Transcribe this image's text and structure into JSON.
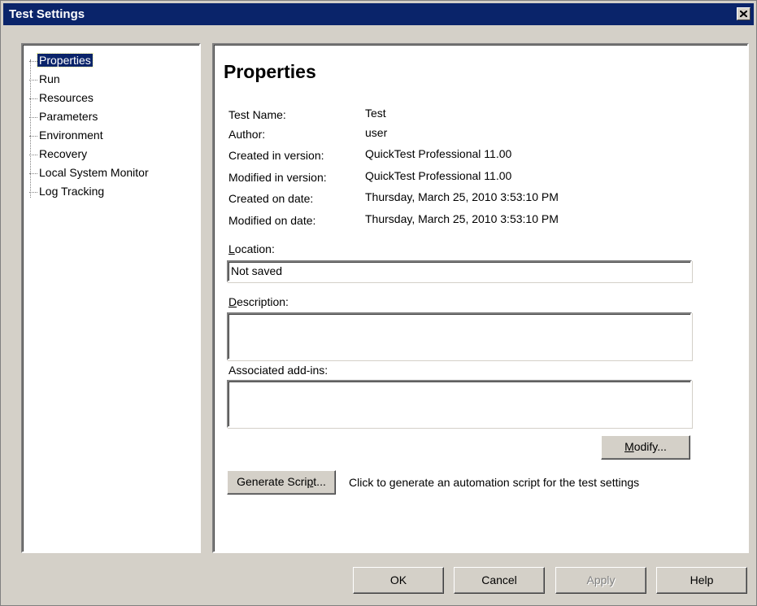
{
  "window": {
    "title": "Test Settings"
  },
  "tree": {
    "items": [
      {
        "label": "Properties",
        "selected": true
      },
      {
        "label": "Run"
      },
      {
        "label": "Resources"
      },
      {
        "label": "Parameters"
      },
      {
        "label": "Environment"
      },
      {
        "label": "Recovery"
      },
      {
        "label": "Local System Monitor"
      },
      {
        "label": "Log Tracking"
      }
    ]
  },
  "properties": {
    "heading": "Properties",
    "rows": [
      {
        "label": "Test Name:",
        "value": "Test"
      },
      {
        "label": "Author:",
        "value": "user"
      },
      {
        "label": "Created in version:",
        "value": "QuickTest Professional 11.00"
      },
      {
        "label": "Modified in version:",
        "value": "QuickTest Professional 11.00"
      },
      {
        "label": "Created on date:",
        "value": "Thursday, March 25, 2010  3:53:10 PM"
      },
      {
        "label": "Modified on date:",
        "value": "Thursday, March 25, 2010  3:53:10 PM"
      }
    ],
    "location_label_prefix": "L",
    "location_label_rest": "ocation:",
    "location_value": "Not saved",
    "description_label_prefix": "D",
    "description_label_rest": "escription:",
    "description_value": "",
    "addins_label": "Associated add-ins:",
    "addins_value": "",
    "modify_prefix": "M",
    "modify_rest": "odify...",
    "generate_label_a": "Generate Scri",
    "generate_label_u": "p",
    "generate_label_b": "t...",
    "generate_hint": "Click to generate an automation script for the test settings"
  },
  "footer": {
    "ok": "OK",
    "cancel": "Cancel",
    "apply": "Apply",
    "help": "Help"
  }
}
